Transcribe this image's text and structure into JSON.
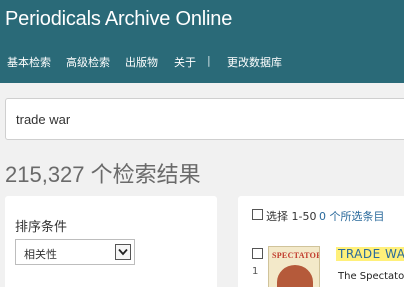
{
  "header": {
    "app_title": "Periodicals Archive Online",
    "nav": [
      "基本检索",
      "高级检索",
      "出版物",
      "关于",
      "|",
      "更改数据库"
    ]
  },
  "search": {
    "query": "trade war"
  },
  "results": {
    "count_label": "215,327 个检索结果",
    "select_range": "选择 1-50",
    "selected_count": "0 个所选条目"
  },
  "sort": {
    "label": "排序条件",
    "value": "相关性"
  },
  "items": [
    {
      "index": "1",
      "thumb_title": "SPECTATOR",
      "title": "TRADE WAR",
      "source": "The Spectator;"
    }
  ],
  "colors": {
    "header_bg": "#2a6a78",
    "link": "#2a6a9c",
    "highlight": "#fff07a"
  }
}
